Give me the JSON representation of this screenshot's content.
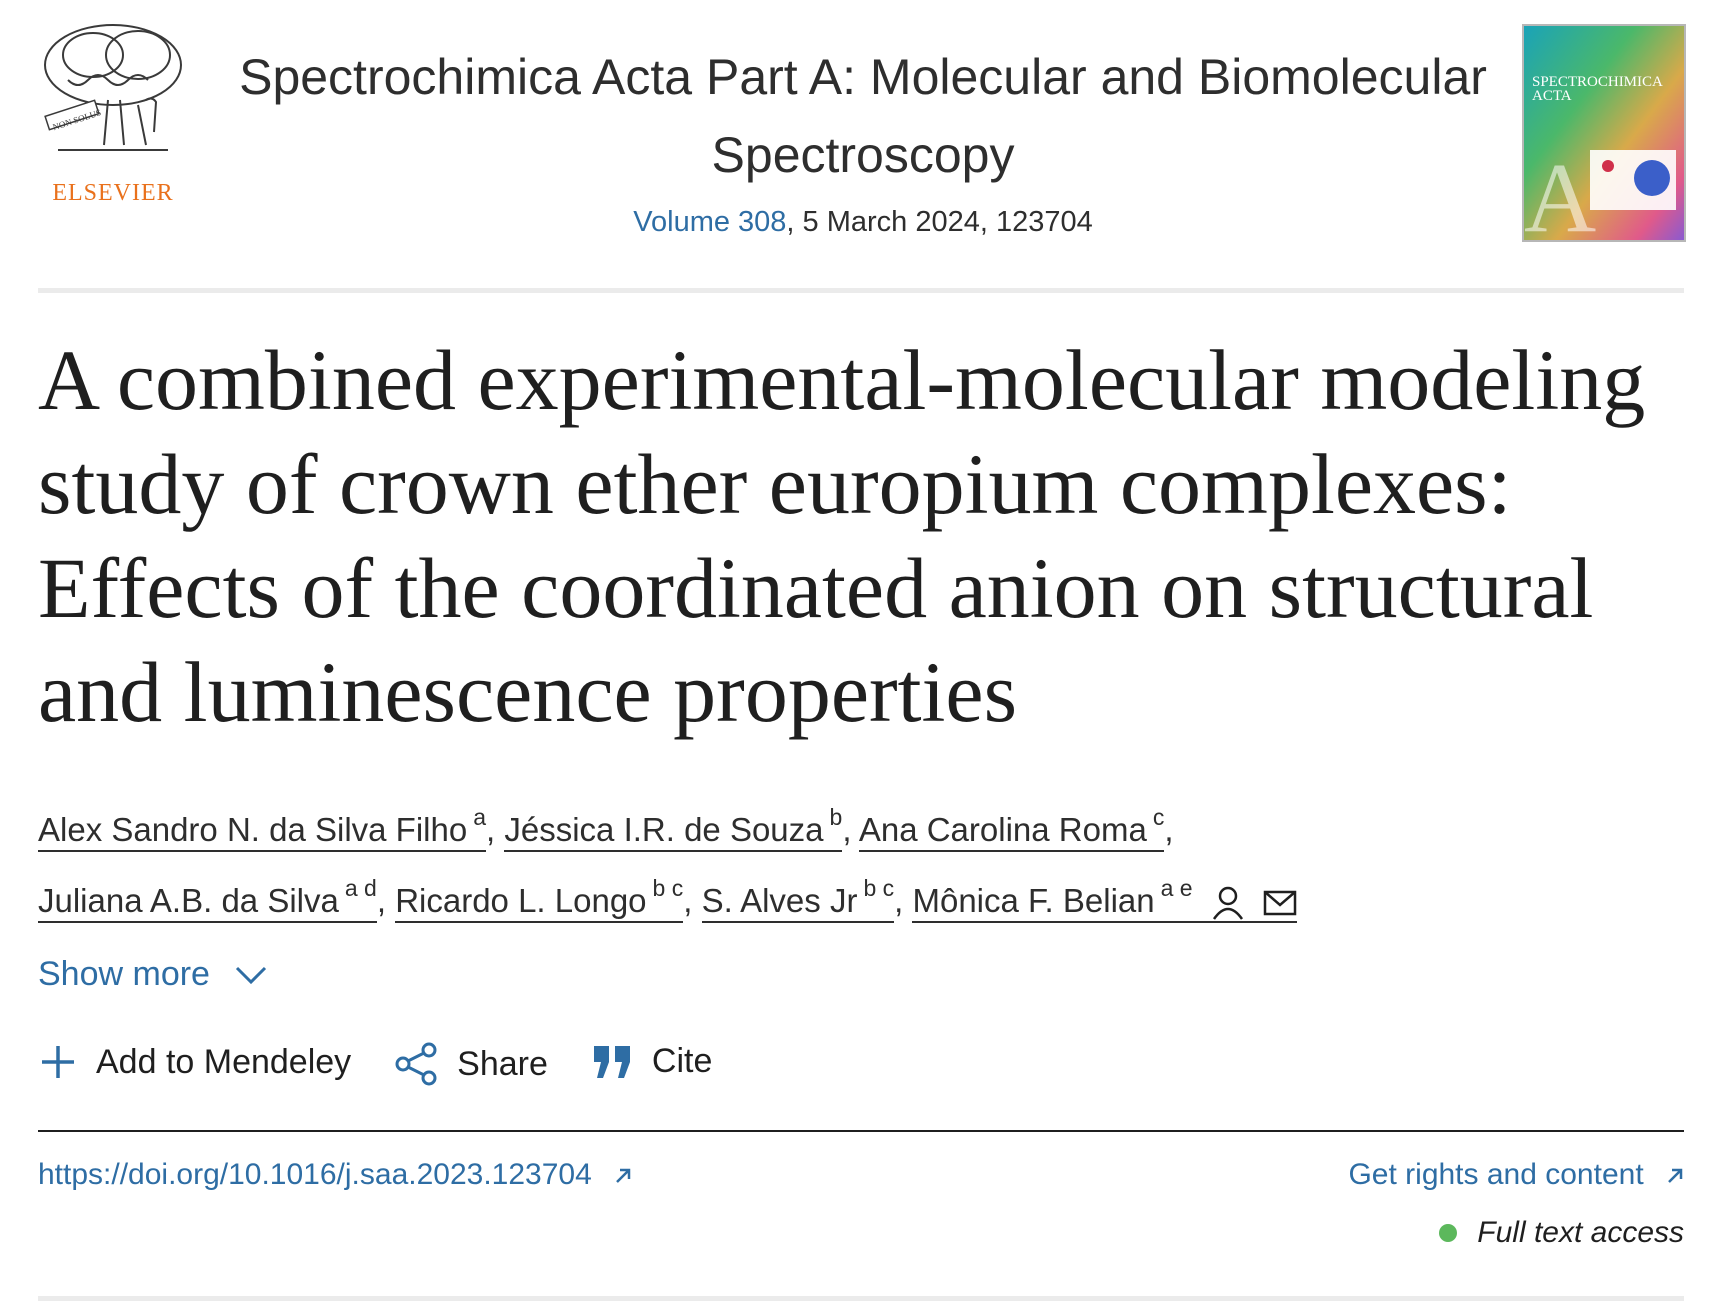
{
  "publisher": {
    "name": "ELSEVIER",
    "logo_motto": "NON SOLUS",
    "icon": "elsevier-tree-logo"
  },
  "journal": {
    "title": "Spectrochimica Acta Part A: Molecular and Biomolecular Spectroscopy",
    "volume_link": "Volume 308",
    "issue_info": ", 5 March 2024, 123704",
    "cover": {
      "title_line1": "SPECTROCHIMICA",
      "title_line2": "ACTA",
      "letter": "A"
    }
  },
  "article": {
    "title": "A combined experimental-molecular modeling study of crown ether europium complexes: Effects of the coordinated anion on structural and luminescence properties"
  },
  "authors": [
    {
      "name": "Alex Sandro N. da Silva Filho",
      "sup": "a"
    },
    {
      "name": "Jéssica I.R. de Souza",
      "sup": "b"
    },
    {
      "name": "Ana Carolina Roma",
      "sup": "c"
    },
    {
      "name": "Juliana A.B. da Silva",
      "sup": "a d"
    },
    {
      "name": "Ricardo L. Longo",
      "sup": "b c"
    },
    {
      "name": "S. Alves Jr",
      "sup": "b c"
    },
    {
      "name": "Mônica F. Belian",
      "sup": "a e",
      "icons": [
        "person-icon",
        "envelope-icon"
      ]
    }
  ],
  "show_more": {
    "label": "Show more",
    "icon": "chevron-down-icon"
  },
  "actions": [
    {
      "label": "Add to Mendeley",
      "icon": "plus-icon"
    },
    {
      "label": "Share",
      "icon": "share-icon"
    },
    {
      "label": "Cite",
      "icon": "quote-icon"
    }
  ],
  "links": {
    "doi": "https://doi.org/10.1016/j.saa.2023.123704",
    "rights": "Get rights and content"
  },
  "access": {
    "label": "Full text access",
    "status_color": "#5cb85c"
  },
  "colors": {
    "link": "#2e6da4",
    "brand_orange": "#e9711c",
    "text": "#1f1f1f"
  }
}
